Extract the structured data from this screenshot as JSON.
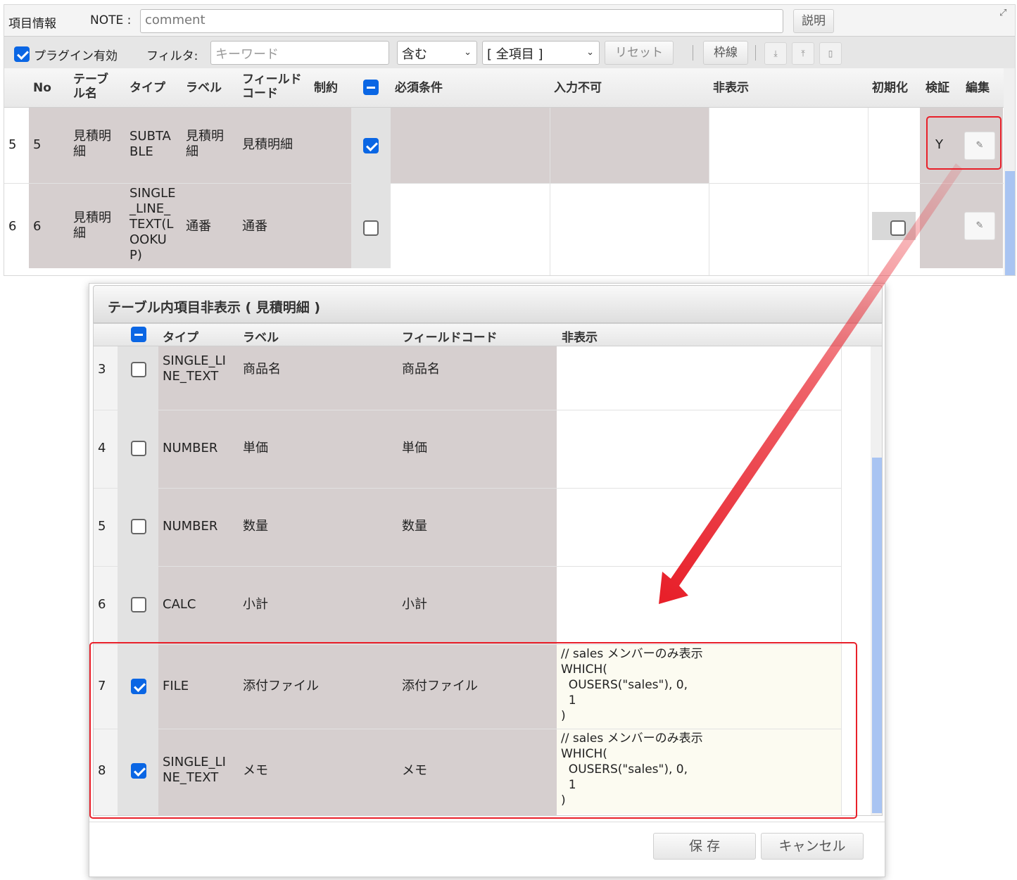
{
  "toolbar": {
    "section_label": "項目情報",
    "note_label": "NOTE :",
    "note_value": "comment",
    "help_button": "説明",
    "plugin_enabled_label": "プラグイン有効",
    "plugin_enabled": true,
    "filter_label": "フィルタ:",
    "keyword_placeholder": "キーワード",
    "match_select": "含む",
    "scope_select": "[ 全項目 ]",
    "reset_button": "リセット",
    "border_button": "枠線",
    "expand_icon": "expand-icon",
    "download_icon": "download-icon",
    "upload_icon": "upload-icon",
    "clipboard_icon": "clipboard-icon"
  },
  "main_table": {
    "headers": {
      "no": "No",
      "table_name": "テーブル名",
      "type": "タイプ",
      "label": "ラベル",
      "field_code": "フィールドコード",
      "constraint": "制約",
      "required": "必須条件",
      "readonly": "入力不可",
      "hidden": "非表示",
      "init": "初期化",
      "verify": "検証",
      "edit": "編集"
    },
    "rows": [
      {
        "index": "5",
        "no": "5",
        "table_name": "見積明細",
        "type": "SUBTABLE",
        "label": "見積明細",
        "field_code": "見積明細",
        "checked": true,
        "init_checkbox": false,
        "verify": "Y"
      },
      {
        "index": "6",
        "no": "6",
        "table_name": "見積明細",
        "type": "SINGLE_LINE_TEXT(LOOKUP)",
        "label": "通番",
        "field_code": "通番",
        "checked": false,
        "init_checkbox": true,
        "init_checked": false,
        "verify": ""
      }
    ]
  },
  "dialog": {
    "title": "テーブル内項目非表示 ( 見積明細 )",
    "headers": {
      "type": "タイプ",
      "label": "ラベル",
      "field_code": "フィールドコード",
      "hidden": "非表示"
    },
    "rows": [
      {
        "index": "3",
        "checked": false,
        "type": "SINGLE_LINE_TEXT",
        "label": "商品名",
        "field_code": "商品名",
        "hidden": ""
      },
      {
        "index": "4",
        "checked": false,
        "type": "NUMBER",
        "label": "単価",
        "field_code": "単価",
        "hidden": ""
      },
      {
        "index": "5",
        "checked": false,
        "type": "NUMBER",
        "label": "数量",
        "field_code": "数量",
        "hidden": ""
      },
      {
        "index": "6",
        "checked": false,
        "type": "CALC",
        "label": "小計",
        "field_code": "小計",
        "hidden": ""
      },
      {
        "index": "7",
        "checked": true,
        "type": "FILE",
        "label": "添付ファイル",
        "field_code": "添付ファイル",
        "hidden": "// sales メンバーのみ表示\nWHICH(\n  OUSERS(\"sales\"), 0,\n  1\n)"
      },
      {
        "index": "8",
        "checked": true,
        "type": "SINGLE_LINE_TEXT",
        "label": "メモ",
        "field_code": "メモ",
        "hidden": "// sales メンバーのみ表示\nWHICH(\n  OUSERS(\"sales\"), 0,\n  1\n)"
      }
    ],
    "save_button": "保 存",
    "cancel_button": "キャンセル"
  },
  "colors": {
    "accent": "#0a66e4",
    "highlight": "#e8202a",
    "band": "#d6cfcf",
    "code_bg": "#fcfbf1"
  }
}
